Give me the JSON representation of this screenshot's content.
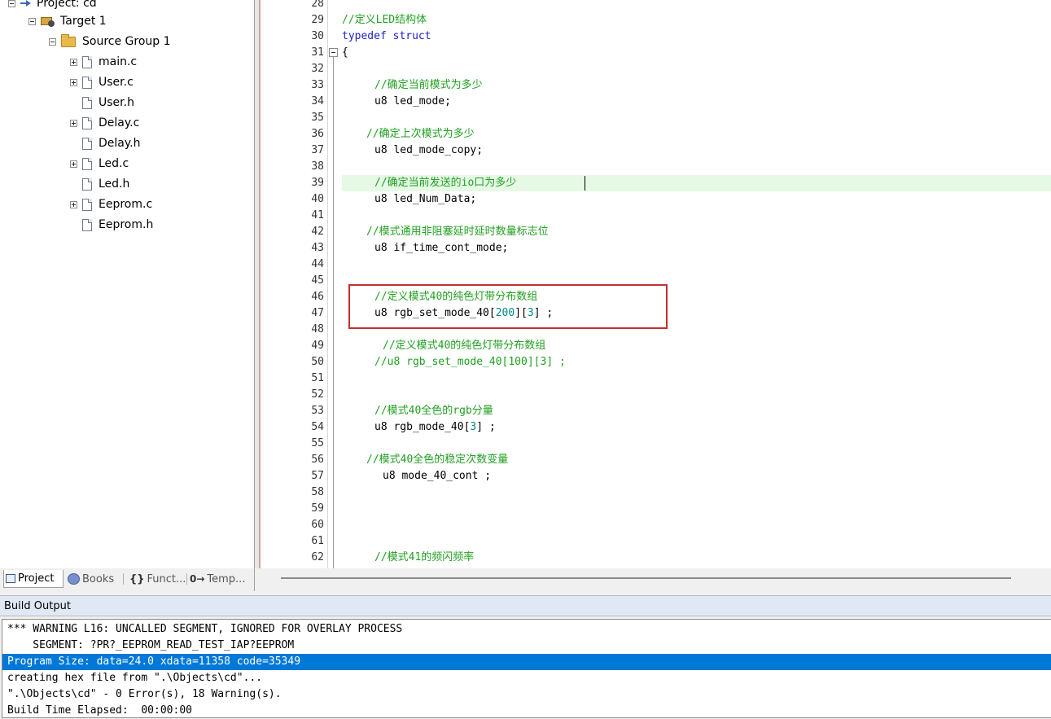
{
  "project_tree": {
    "project_label": "Project: cd",
    "target_label": "Target 1",
    "group_label": "Source Group 1",
    "files": [
      {
        "name": "main.c",
        "expandable": true
      },
      {
        "name": "User.c",
        "expandable": true
      },
      {
        "name": "User.h",
        "expandable": false
      },
      {
        "name": "Delay.c",
        "expandable": true
      },
      {
        "name": "Delay.h",
        "expandable": false
      },
      {
        "name": "Led.c",
        "expandable": true
      },
      {
        "name": "Led.h",
        "expandable": false
      },
      {
        "name": "Eeprom.c",
        "expandable": true
      },
      {
        "name": "Eeprom.h",
        "expandable": false
      }
    ]
  },
  "panel_tabs": {
    "project": "Project",
    "books": "Books",
    "functions": "Funct...",
    "templates": "Temp...",
    "functions_icon": "{}",
    "templates_icon": "0→"
  },
  "editor": {
    "line_numbers": [
      "28",
      "29",
      "30",
      "31",
      "32",
      "33",
      "34",
      "35",
      "36",
      "37",
      "38",
      "39",
      "40",
      "41",
      "42",
      "43",
      "44",
      "45",
      "46",
      "47",
      "48",
      "49",
      "50",
      "51",
      "52",
      "53",
      "54",
      "55",
      "56",
      "57",
      "58",
      "59",
      "60",
      "61",
      "62"
    ],
    "lines": {
      "l29": "//定义LED结构体",
      "l30": "typedef struct",
      "l31": "{",
      "l33": "//确定当前模式为多少",
      "l34": "u8 led_mode;",
      "l36": "//确定上次模式为多少",
      "l37": "u8 led_mode_copy;",
      "l39": "//确定当前发送的io口为多少",
      "l40": "u8 led_Num_Data;",
      "l42": "//模式通用非阻塞延时延时数量标志位",
      "l43": "u8 if_time_cont_mode;",
      "l46": "//定义模式40的纯色灯带分布数组",
      "l47_a": "u8 rgb_set_mode_40[",
      "l47_b": "200",
      "l47_c": "][",
      "l47_d": "3",
      "l47_e": "] ;",
      "l49": "//定义模式40的纯色灯带分布数组",
      "l50_a": "//u8 rgb_set_mode_40[100][3] ;",
      "l53": "//模式40全色的rgb分量",
      "l54_a": "u8 rgb_mode_40[",
      "l54_b": "3",
      "l54_c": "] ;",
      "l56": "//模式40全色的稳定次数变量",
      "l57": "u8 mode_40_cont ;",
      "l62": "//模式41的频闪频率"
    }
  },
  "build_output": {
    "title": "Build Output",
    "lines": [
      "*** WARNING L16: UNCALLED SEGMENT, IGNORED FOR OVERLAY PROCESS",
      "    SEGMENT: ?PR?_EEPROM_READ_TEST_IAP?EEPROM",
      "Program Size: data=24.0 xdata=11358 code=35349",
      "creating hex file from \".\\Objects\\cd\"...",
      "\".\\Objects\\cd\" - 0 Error(s), 18 Warning(s).",
      "Build Time Elapsed:  00:00:00"
    ]
  },
  "colors": {
    "comment": "#22a022",
    "keyword": "#2020c0",
    "number": "#00868b",
    "current_line": "#e5f9e5",
    "selection": "#0078d7",
    "highlight_box": "#c03030"
  }
}
